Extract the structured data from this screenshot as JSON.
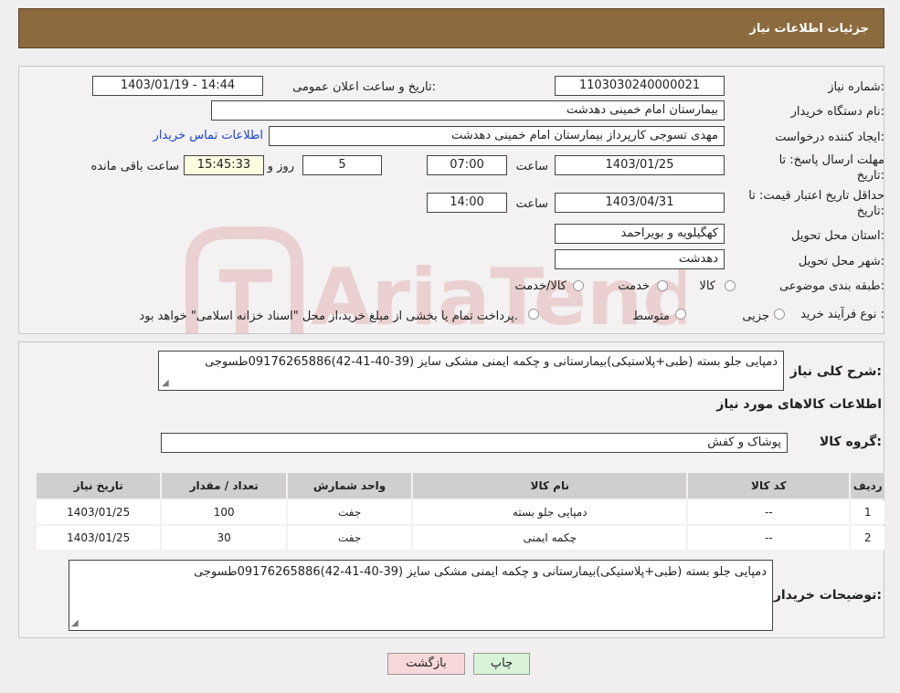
{
  "header": {
    "title": "جزئیات اطلاعات نیاز"
  },
  "form": {
    "need_number_label": "شماره نیاز:",
    "need_number": "1103030240000021",
    "announce_label": "تاریخ و ساعت اعلان عمومی:",
    "announce_value": "1403/01/19 - 14:44",
    "buyer_org_label": "نام دستگاه خریدار:",
    "buyer_org": "بیمارستان امام خمینی دهدشت",
    "creator_label": "ایجاد کننده درخواست:",
    "creator": "مهدی تسوجی کارپرداز بیمارستان امام خمینی دهدشت",
    "contact_link": "اطلاعات تماس خریدار",
    "deadline_label": "مهلت ارسال پاسخ: تا تاریخ:",
    "deadline_date": "1403/01/25",
    "time_label": "ساعت",
    "deadline_time": "07:00",
    "days_value": "5",
    "days_label": "روز و",
    "remaining_time": "15:45:33",
    "remaining_label": "ساعت باقی مانده",
    "price_valid_label": "حداقل تاریخ اعتبار قیمت: تا تاریخ:",
    "price_valid_date": "1403/04/31",
    "price_valid_time": "14:00",
    "province_label": "استان محل تحویل:",
    "province": "کهگیلویه و بویراحمد",
    "city_label": "شهر محل تحویل:",
    "city": "دهدشت",
    "category_label": "طبقه بندی موضوعی:",
    "category_options": [
      "کالا",
      "خدمت",
      "کالا/خدمت"
    ],
    "process_label": "نوع فرآیند خرید :",
    "process_options": [
      "جزیی",
      "متوسط"
    ],
    "process_note": "پرداخت تمام یا بخشی از مبلغ خرید،از محل \"اسناد خزانه اسلامی\" خواهد بود."
  },
  "details": {
    "summary_label": "شرح کلی نیاز:",
    "summary_text": "دمپایی جلو بسته (طبی+پلاستیکی)بیمارستانی و چکمه ایمنی مشکی سایز (39-40-41-42)09176265886طسوجی",
    "goods_info_title": "اطلاعات کالاهای مورد نیاز",
    "goods_group_label": "گروه کالا:",
    "goods_group": "پوشاک و کفش",
    "table": {
      "columns": [
        "ردیف",
        "کد کالا",
        "نام کالا",
        "واحد شمارش",
        "تعداد / مقدار",
        "تاریخ نیاز"
      ],
      "rows": [
        [
          "1",
          "--",
          "دمپایی جلو بسته",
          "جفت",
          "100",
          "1403/01/25"
        ],
        [
          "2",
          "--",
          "چکمه ایمنی",
          "جفت",
          "30",
          "1403/01/25"
        ]
      ]
    },
    "buyer_notes_label": "توضیحات خریدار:",
    "buyer_notes": "دمپایی جلو بسته (طبی+پلاستیکی)بیمارستانی و چکمه ایمنی مشکی سایز (39-40-41-42)09176265886طسوجی"
  },
  "buttons": {
    "print": "چاپ",
    "back": "بازگشت"
  },
  "watermark": {
    "text": "AriaTender.neT"
  },
  "colors": {
    "header_bg": "#8b6a3e",
    "link": "#1a45d0",
    "remaining_bg": "#fdfbe0",
    "print_bg": "#d8f3d8",
    "back_bg": "#f7d8d8"
  }
}
